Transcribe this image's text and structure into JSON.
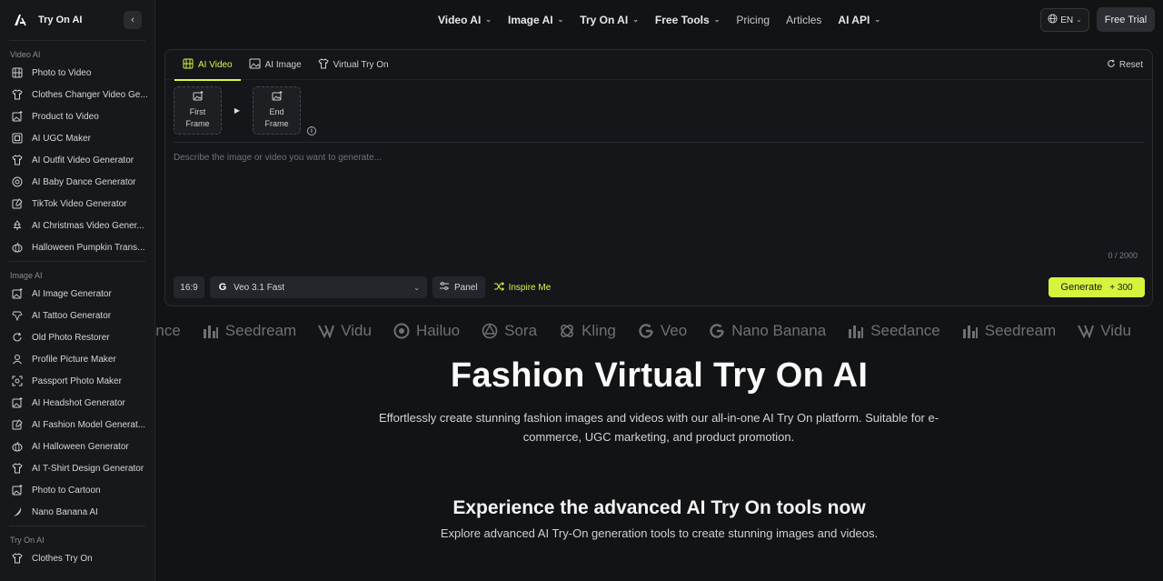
{
  "brand": {
    "name": "Try On AI",
    "collapse_icon": "chevron-left-icon"
  },
  "sidebar": {
    "sections": [
      {
        "title": "Video AI",
        "items": [
          {
            "label": "Photo to Video",
            "icon": "film-icon"
          },
          {
            "label": "Clothes Changer Video Ge...",
            "icon": "shirt-icon"
          },
          {
            "label": "Product to Video",
            "icon": "image-plus-icon"
          },
          {
            "label": "AI UGC Maker",
            "icon": "ugc-icon"
          },
          {
            "label": "AI Outfit Video Generator",
            "icon": "shirt-icon"
          },
          {
            "label": "AI Baby Dance Generator",
            "icon": "baby-icon"
          },
          {
            "label": "TikTok Video Generator",
            "icon": "edit-image-icon"
          },
          {
            "label": "AI Christmas Video Gener...",
            "icon": "tree-icon"
          },
          {
            "label": "Halloween Pumpkin Trans...",
            "icon": "pumpkin-icon"
          }
        ]
      },
      {
        "title": "Image AI",
        "items": [
          {
            "label": "AI Image Generator",
            "icon": "image-plus-icon"
          },
          {
            "label": "AI Tattoo Generator",
            "icon": "tattoo-icon"
          },
          {
            "label": "Old Photo Restorer",
            "icon": "restore-icon"
          },
          {
            "label": "Profile Picture Maker",
            "icon": "user-icon"
          },
          {
            "label": "Passport Photo Maker",
            "icon": "scan-face-icon"
          },
          {
            "label": "AI Headshot Generator",
            "icon": "image-plus-icon"
          },
          {
            "label": "AI Fashion Model Generat...",
            "icon": "edit-image-icon"
          },
          {
            "label": "AI Halloween Generator",
            "icon": "pumpkin-icon"
          },
          {
            "label": "AI T-Shirt Design Generator",
            "icon": "shirt-icon"
          },
          {
            "label": "Photo to Cartoon",
            "icon": "image-plus-icon"
          },
          {
            "label": "Nano Banana AI",
            "icon": "banana-icon"
          }
        ]
      },
      {
        "title": "Try On AI",
        "items": [
          {
            "label": "Clothes Try On",
            "icon": "shirt-icon"
          }
        ]
      }
    ]
  },
  "nav": {
    "items": [
      {
        "label": "Video AI",
        "dropdown": true,
        "bold": true
      },
      {
        "label": "Image AI",
        "dropdown": true,
        "bold": true
      },
      {
        "label": "Try On AI",
        "dropdown": true,
        "bold": true
      },
      {
        "label": "Free Tools",
        "dropdown": true,
        "bold": true
      },
      {
        "label": "Pricing",
        "dropdown": false,
        "bold": false
      },
      {
        "label": "Articles",
        "dropdown": false,
        "bold": false
      },
      {
        "label": "AI API",
        "dropdown": true,
        "bold": true
      }
    ],
    "language": "EN",
    "free_trial": "Free Trial"
  },
  "generator": {
    "tabs": [
      {
        "label": "AI Video",
        "icon": "film-icon",
        "active": true
      },
      {
        "label": "AI Image",
        "icon": "image-icon",
        "active": false
      },
      {
        "label": "Virtual Try On",
        "icon": "shirt-icon",
        "active": false
      }
    ],
    "reset_label": "Reset",
    "first_frame_line1": "First",
    "first_frame_line2": "Frame",
    "end_frame_line1": "End",
    "end_frame_line2": "Frame",
    "prompt_placeholder": "Describe the image or video you want to generate...",
    "char_count": "0 / 2000",
    "aspect_ratio": "16:9",
    "model": "Veo 3.1 Fast",
    "model_logo": "G",
    "panel_label": "Panel",
    "inspire_label": "Inspire Me",
    "generate_label": "Generate",
    "generate_cost": "+ 300",
    "accent_color": "#d6f43d"
  },
  "models_marquee": [
    {
      "label": "edance",
      "icon": "none"
    },
    {
      "label": "Seedream",
      "icon": "bars-icon"
    },
    {
      "label": "Vidu",
      "icon": "vidu-icon"
    },
    {
      "label": "Hailuo",
      "icon": "hailuo-icon"
    },
    {
      "label": "Sora",
      "icon": "openai-icon"
    },
    {
      "label": "Kling",
      "icon": "kling-icon"
    },
    {
      "label": "Veo",
      "icon": "google-icon"
    },
    {
      "label": "Nano Banana",
      "icon": "google-icon"
    },
    {
      "label": "Seedance",
      "icon": "bars-icon"
    },
    {
      "label": "Seedream",
      "icon": "bars-icon"
    },
    {
      "label": "Vidu",
      "icon": "vidu-icon"
    }
  ],
  "hero": {
    "title": "Fashion Virtual Try On AI",
    "subtitle": "Effortlessly create stunning fashion images and videos with our all-in-one AI Try On platform. Suitable for e-commerce, UGC marketing, and product promotion."
  },
  "section2": {
    "title": "Experience the advanced AI Try On tools now",
    "subtitle": "Explore advanced AI Try-On generation tools to create stunning images and videos."
  }
}
